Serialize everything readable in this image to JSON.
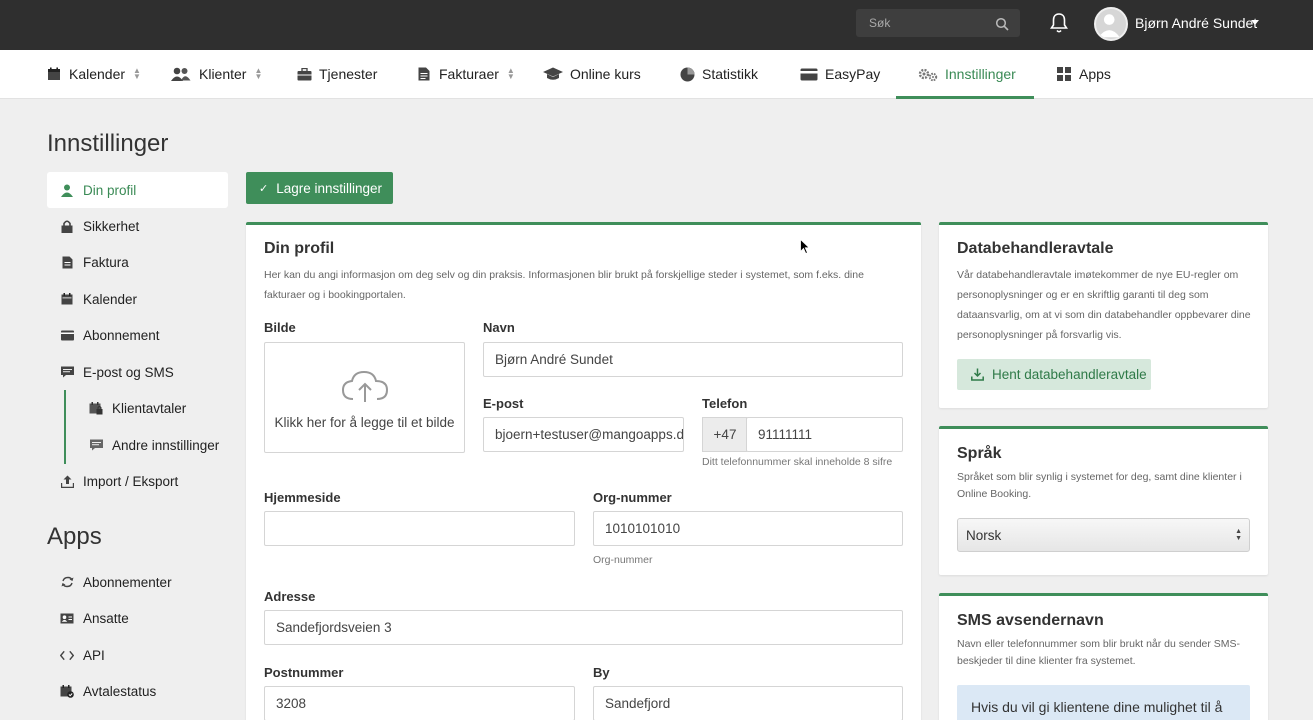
{
  "topbar": {
    "search_placeholder": "Søk",
    "user_name": "Bjørn André Sundet"
  },
  "nav": {
    "items": [
      {
        "label": "Kalender",
        "icon": "calendar-icon",
        "sortable": true
      },
      {
        "label": "Klienter",
        "icon": "users-icon",
        "sortable": true
      },
      {
        "label": "Tjenester",
        "icon": "briefcase-icon",
        "sortable": false
      },
      {
        "label": "Fakturaer",
        "icon": "document-icon",
        "sortable": true
      },
      {
        "label": "Online kurs",
        "icon": "graduation-cap-icon",
        "sortable": false
      },
      {
        "label": "Statistikk",
        "icon": "pie-chart-icon",
        "sortable": false
      },
      {
        "label": "EasyPay",
        "icon": "credit-card-icon",
        "sortable": false
      },
      {
        "label": "Innstillinger",
        "icon": "gears-icon",
        "sortable": false,
        "active": true
      },
      {
        "label": "Apps",
        "icon": "apps-grid-icon",
        "sortable": false
      }
    ]
  },
  "page": {
    "title": "Innstillinger",
    "apps_title": "Apps"
  },
  "sidebar": {
    "items": [
      {
        "label": "Din profil",
        "icon": "user-icon",
        "active": true
      },
      {
        "label": "Sikkerhet",
        "icon": "lock-icon"
      },
      {
        "label": "Faktura",
        "icon": "document-icon"
      },
      {
        "label": "Kalender",
        "icon": "calendar-icon"
      },
      {
        "label": "Abonnement",
        "icon": "card-icon"
      },
      {
        "label": "E-post og SMS",
        "icon": "message-icon"
      },
      {
        "label": "Klientavtaler",
        "icon": "calendar-lock-icon",
        "sub": true
      },
      {
        "label": "Andre innstillinger",
        "icon": "message-icon",
        "sub": true
      },
      {
        "label": "Import / Eksport",
        "icon": "upload-icon"
      }
    ],
    "apps": [
      {
        "label": "Abonnementer",
        "icon": "refresh-icon"
      },
      {
        "label": "Ansatte",
        "icon": "id-card-icon"
      },
      {
        "label": "API",
        "icon": "code-icon"
      },
      {
        "label": "Avtalestatus",
        "icon": "calendar-check-icon"
      }
    ]
  },
  "actions": {
    "save_label": "Lagre innstillinger"
  },
  "profile": {
    "title": "Din profil",
    "description": "Her kan du angi informasjon om deg selv og din praksis. Informasjonen blir brukt på forskjellige steder i systemet, som f.eks. dine fakturaer og i bookingportalen.",
    "image_label": "Bilde",
    "upload_text": "Klikk her for å legge til et bilde",
    "name_label": "Navn",
    "name_value": "Bjørn André Sundet",
    "email_label": "E-post",
    "email_value": "bjoern+testuser@mangoapps.d",
    "phone_label": "Telefon",
    "phone_prefix": "+47",
    "phone_value": "91111111",
    "phone_hint": "Ditt telefonnummer skal inneholde 8 sifre",
    "website_label": "Hjemmeside",
    "website_value": "",
    "org_label": "Org-nummer",
    "org_value": "1010101010",
    "org_hint": "Org-nummer",
    "address_label": "Adresse",
    "address_value": "Sandefjordsveien 3",
    "postal_label": "Postnummer",
    "postal_value": "3208",
    "city_label": "By",
    "city_value": "Sandefjord"
  },
  "data_agreement": {
    "title": "Databehandleravtale",
    "description": "Vår databehandleravtale imøtekommer de nye EU-regler om personoplysninger og er en skriftlig garanti til deg som dataansvarlig, om at vi som din databehandler oppbevarer dine personoplysninger på forsvarlig vis.",
    "button_label": "Hent databehandleravtale"
  },
  "language": {
    "title": "Språk",
    "description": "Språket som blir synlig i systemet for deg, samt dine klienter i Online Booking.",
    "selected": "Norsk"
  },
  "sms_sender": {
    "title": "SMS avsendernavn",
    "description": "Navn eller telefonnummer som blir brukt når du sender SMS-beskjeder til dine klienter fra systemet.",
    "info_text": "Hvis du vil gi klientene dine mulighet til å svare"
  },
  "colors": {
    "accent": "#3f8e5a",
    "topbar": "#2f2f2f",
    "info_bg": "#dbe8f5"
  }
}
